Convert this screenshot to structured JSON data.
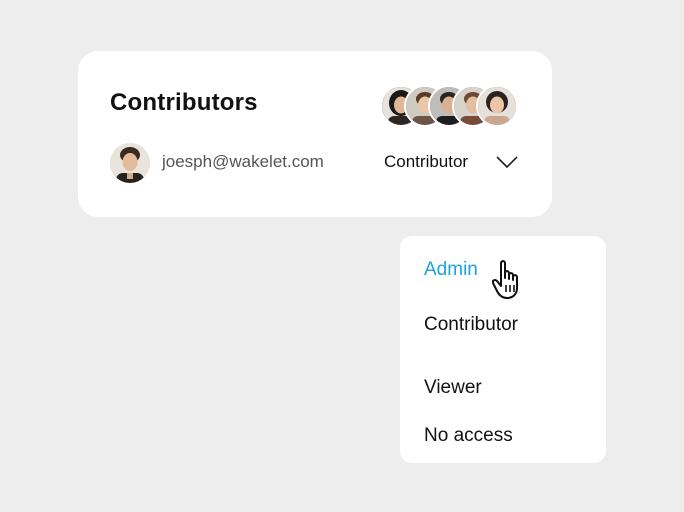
{
  "card": {
    "title": "Contributors",
    "collaborator_avatars": [
      "avatar-1",
      "avatar-2",
      "avatar-3",
      "avatar-4",
      "avatar-5"
    ],
    "user": {
      "email": "joesph@wakelet.com",
      "role": "Contributor"
    }
  },
  "dropdown": {
    "items": [
      {
        "label": "Admin",
        "active": true
      },
      {
        "label": "Contributor",
        "active": false
      },
      {
        "label": "Viewer",
        "active": false
      },
      {
        "label": "No access",
        "active": false
      }
    ]
  },
  "colors": {
    "background": "#ededed",
    "card": "#ffffff",
    "accent": "#1aa3dd",
    "text_primary": "#111111",
    "text_secondary": "#555555"
  },
  "icons": {
    "chevron": "chevron-down-icon",
    "cursor": "hand-pointer-cursor-icon"
  }
}
